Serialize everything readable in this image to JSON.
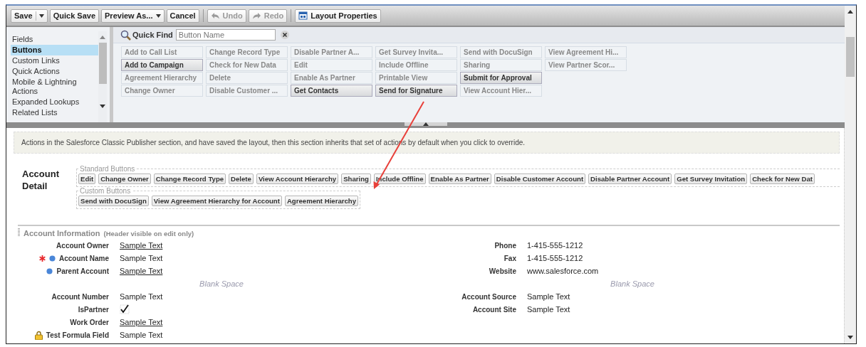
{
  "toolbar": {
    "buttons": [
      {
        "kind": "split",
        "label": "Save",
        "disabled": false
      },
      {
        "kind": "plain",
        "label": "Quick Save",
        "disabled": false
      },
      {
        "kind": "dropdown",
        "label": "Preview As...",
        "disabled": false
      },
      {
        "kind": "plain",
        "label": "Cancel",
        "disabled": false
      },
      {
        "kind": "separator"
      },
      {
        "kind": "undo",
        "label": "Undo",
        "disabled": true
      },
      {
        "kind": "redo",
        "label": "Redo",
        "disabled": true
      },
      {
        "kind": "separator"
      },
      {
        "kind": "properties",
        "label": "Layout Properties",
        "disabled": false
      }
    ]
  },
  "palette": {
    "categories": [
      {
        "label": "Fields",
        "selected": false
      },
      {
        "label": "Buttons",
        "selected": true
      },
      {
        "label": "Custom Links",
        "selected": false
      },
      {
        "label": "Quick Actions",
        "selected": false
      },
      {
        "label": "Mobile & Lightning Actions",
        "selected": false
      },
      {
        "label": "Expanded Lookups",
        "selected": false
      },
      {
        "label": "Related Lists",
        "selected": false
      }
    ],
    "quick_find": {
      "label": "Quick Find",
      "placeholder": "Button Name"
    },
    "items": [
      {
        "label": "Add to Call List",
        "on_layout": true
      },
      {
        "label": "Add to Campaign",
        "on_layout": false
      },
      {
        "label": "Agreement Hierarchy",
        "on_layout": true
      },
      {
        "label": "Change Owner",
        "on_layout": true
      },
      {
        "label": "Change Record Type",
        "on_layout": true
      },
      {
        "label": "Check for New Data",
        "on_layout": true
      },
      {
        "label": "Delete",
        "on_layout": true
      },
      {
        "label": "Disable Customer ...",
        "on_layout": true
      },
      {
        "label": "Disable Partner A...",
        "on_layout": true
      },
      {
        "label": "Edit",
        "on_layout": true
      },
      {
        "label": "Enable As Partner",
        "on_layout": true
      },
      {
        "label": "Get Contacts",
        "on_layout": false
      },
      {
        "label": "Get Survey Invita...",
        "on_layout": true
      },
      {
        "label": "Include Offline",
        "on_layout": true
      },
      {
        "label": "Printable View",
        "on_layout": true
      },
      {
        "label": "Send for Signature",
        "on_layout": false
      },
      {
        "label": "Send with DocuSign",
        "on_layout": true
      },
      {
        "label": "Sharing",
        "on_layout": true
      },
      {
        "label": "Submit for Approval",
        "on_layout": false
      },
      {
        "label": "View Account Hier...",
        "on_layout": true
      },
      {
        "label": "View Agreement Hi...",
        "on_layout": true
      },
      {
        "label": "View Partner Scor...",
        "on_layout": true
      }
    ]
  },
  "info_text": "Actions in the Salesforce Classic Publisher section, and have saved the layout, then this section inherits that set of actions by default when you click to override.",
  "detail": {
    "title": "Account Detail",
    "groups": [
      {
        "legend": "Standard Buttons",
        "buttons": [
          "Edit",
          "Change Owner",
          "Change Record Type",
          "Delete",
          "View Account Hierarchy",
          "Sharing",
          "Include Offline",
          "Enable As Partner",
          "Disable Customer Account",
          "Disable Partner Account",
          "Get Survey Invitation",
          "Check for New Dat"
        ]
      },
      {
        "legend": "Custom Buttons",
        "buttons": [
          "Send with DocuSign",
          "View Agreement Hierarchy for Account",
          "Agreement Hierarchy"
        ]
      }
    ]
  },
  "section": {
    "title": "Account Information",
    "note": "(Header visible on edit only)",
    "columns": [
      {
        "fields": [
          {
            "kind": "link",
            "label": "Account Owner",
            "value": "Sample Text",
            "required": false,
            "always_displayed": false,
            "read_only": false
          },
          {
            "kind": "text",
            "label": "Account Name",
            "value": "Sample Text",
            "required": true,
            "always_displayed": true,
            "read_only": false
          },
          {
            "kind": "link",
            "label": "Parent Account",
            "value": "Sample Text",
            "required": false,
            "always_displayed": true,
            "read_only": false
          },
          {
            "kind": "blank",
            "label": "Blank Space"
          },
          {
            "kind": "text",
            "label": "Account Number",
            "value": "Sample Text",
            "required": false,
            "always_displayed": false,
            "read_only": false
          },
          {
            "kind": "checkbox",
            "label": "IsPartner",
            "checked": true,
            "required": false,
            "always_displayed": false,
            "read_only": false
          },
          {
            "kind": "link",
            "label": "Work Order",
            "value": "Sample Text",
            "required": false,
            "always_displayed": false,
            "read_only": false
          },
          {
            "kind": "text",
            "label": "Test Formula Field",
            "value": "Sample Text",
            "required": false,
            "always_displayed": false,
            "read_only": true
          }
        ]
      },
      {
        "fields": [
          {
            "kind": "text",
            "label": "Phone",
            "value": "1-415-555-1212",
            "required": false,
            "always_displayed": false,
            "read_only": false
          },
          {
            "kind": "text",
            "label": "Fax",
            "value": "1-415-555-1212",
            "required": false,
            "always_displayed": false,
            "read_only": false
          },
          {
            "kind": "text",
            "label": "Website",
            "value": "www.salesforce.com",
            "required": false,
            "always_displayed": false,
            "read_only": false
          },
          {
            "kind": "blank",
            "label": "Blank Space"
          },
          {
            "kind": "text",
            "label": "Account Source",
            "value": "Sample Text",
            "required": false,
            "always_displayed": false,
            "read_only": false
          },
          {
            "kind": "text",
            "label": "Account Site",
            "value": "Sample Text",
            "required": false,
            "always_displayed": false,
            "read_only": false
          }
        ]
      }
    ]
  }
}
